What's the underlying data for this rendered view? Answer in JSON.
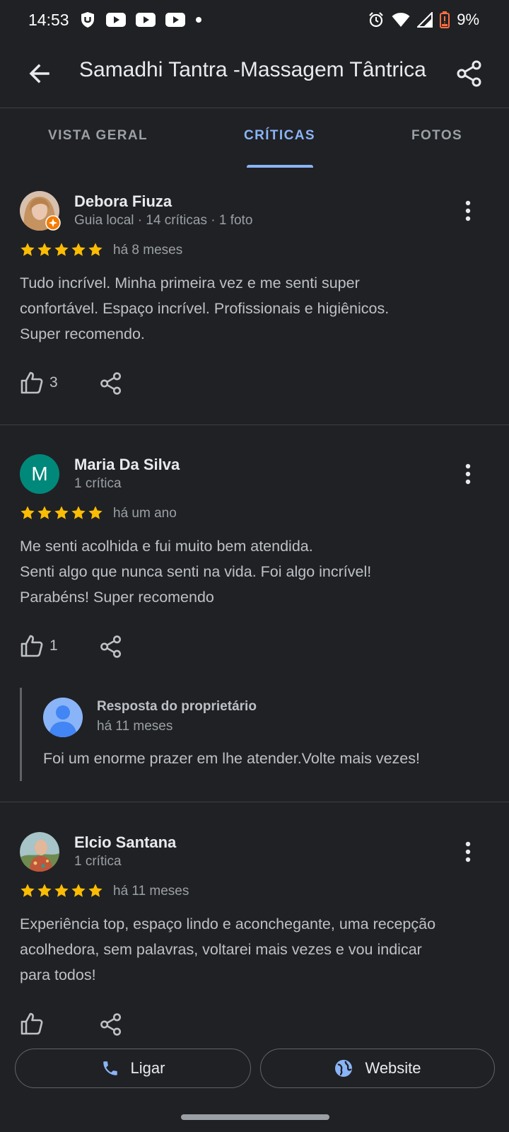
{
  "status_bar": {
    "time": "14:53",
    "battery": "9%",
    "left_icons": [
      "ublock-icon",
      "youtube-icon",
      "youtube-icon",
      "youtube-icon",
      "dot-icon"
    ],
    "right_icons": [
      "alarm-icon",
      "wifi-icon",
      "signal-icon",
      "battery-low-icon"
    ]
  },
  "toolbar": {
    "title": "Samadhi Tantra -Massagem Tântrica"
  },
  "tabs": [
    {
      "label": "VISTA GERAL",
      "active": false
    },
    {
      "label": "CRÍTICAS",
      "active": true
    },
    {
      "label": "FOTOS",
      "active": false
    }
  ],
  "reviews": [
    {
      "name": "Debora Fiuza",
      "meta": "Guia local · 14 críticas · 1 foto",
      "stars": 5,
      "date": "há 8 meses",
      "text": [
        "Tudo incrível. Minha primeira vez e me senti super",
        "confortável. Espaço incrível. Profissionais e higiênicos.",
        "Super recomendo."
      ],
      "likes": "3"
    },
    {
      "name": "Maria Da Silva",
      "avatar_letter": "M",
      "meta": "1 crítica",
      "stars": 5,
      "date": "há um ano",
      "text": [
        "Me senti acolhida e fui muito bem atendida.",
        "Senti algo que nunca senti na vida. Foi algo incrível!",
        "Parabéns! Super recomendo"
      ],
      "likes": "1",
      "owner_reply": {
        "title": "Resposta do proprietário",
        "date": "há 11 meses",
        "text": "Foi um enorme prazer em lhe atender.Volte mais vezes!"
      }
    },
    {
      "name": "Elcio Santana",
      "meta": "1 crítica",
      "stars": 5,
      "date": "há 11 meses",
      "text": [
        "Experiência top, espaço lindo e aconchegante, uma recepção",
        "acolhedora, sem palavras, voltarei mais vezes e vou indicar",
        "para todos!"
      ],
      "likes": ""
    }
  ],
  "actions": {
    "call_label": "Ligar",
    "website_label": "Website"
  },
  "colors": {
    "background": "#202124",
    "accent": "#8ab4f8",
    "star": "#fbbc04",
    "avatar_green": "#00897b"
  }
}
